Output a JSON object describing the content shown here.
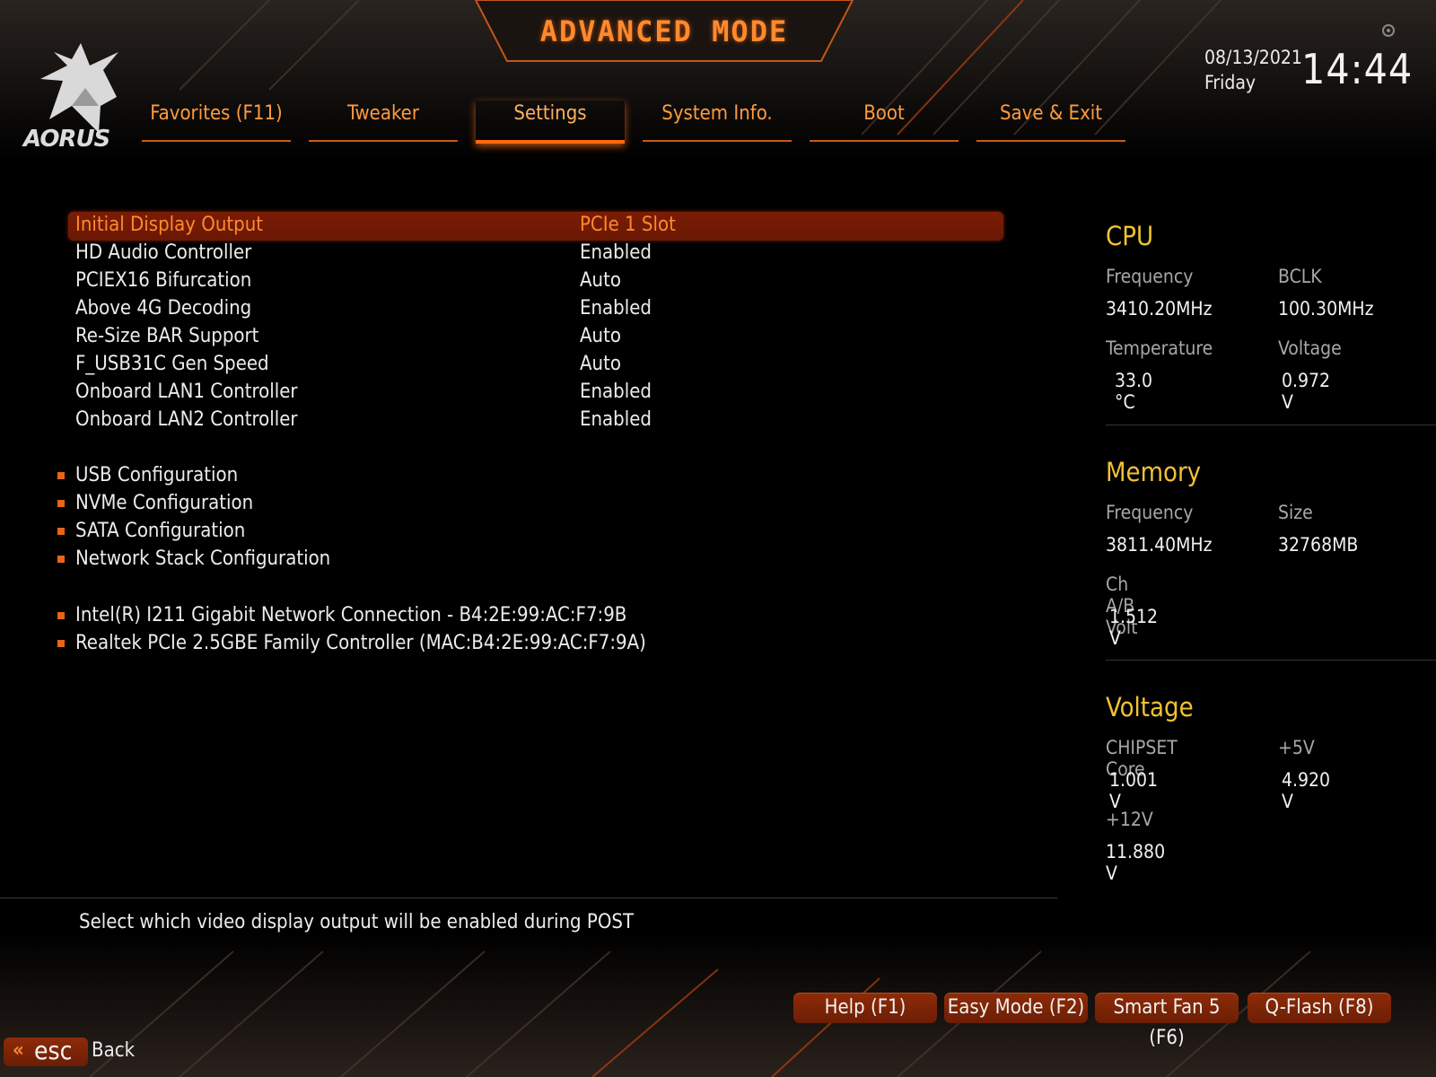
{
  "header": {
    "logo_text": "AORUS",
    "mode_title": "ADVANCED MODE",
    "tabs": [
      {
        "label": "Favorites (F11)"
      },
      {
        "label": "Tweaker"
      },
      {
        "label": "Settings"
      },
      {
        "label": "System Info."
      },
      {
        "label": "Boot"
      },
      {
        "label": "Save & Exit"
      }
    ],
    "active_tab": "Settings",
    "date": "08/13/2021",
    "weekday": "Friday",
    "time": "14:44"
  },
  "settings": [
    {
      "label": "Initial Display Output",
      "value": "PCIe 1 Slot"
    },
    {
      "label": "HD Audio Controller",
      "value": "Enabled"
    },
    {
      "label": "PCIEX16 Bifurcation",
      "value": "Auto"
    },
    {
      "label": "Above 4G Decoding",
      "value": "Enabled"
    },
    {
      "label": "Re-Size BAR Support",
      "value": "Auto"
    },
    {
      "label": "F_USB31C Gen Speed",
      "value": "Auto"
    },
    {
      "label": "Onboard LAN1 Controller",
      "value": "Enabled"
    },
    {
      "label": "Onboard LAN2 Controller",
      "value": "Enabled"
    }
  ],
  "submenus": [
    {
      "label": "USB Configuration"
    },
    {
      "label": "NVMe Configuration"
    },
    {
      "label": "SATA Configuration"
    },
    {
      "label": "Network Stack Configuration"
    }
  ],
  "network_devices": [
    {
      "label": "Intel(R) I211 Gigabit  Network Connection - B4:2E:99:AC:F7:9B"
    },
    {
      "label": "Realtek PCIe 2.5GBE Family Controller (MAC:B4:2E:99:AC:F7:9A)"
    }
  ],
  "monitor": {
    "cpu": {
      "title": "CPU",
      "freq_label": "Frequency",
      "freq_value": "3410.20MHz",
      "bclk_label": "BCLK",
      "bclk_value": "100.30MHz",
      "temp_label": "Temperature",
      "temp_value": "33.0 °C",
      "volt_label": "Voltage",
      "volt_value": "0.972 V"
    },
    "memory": {
      "title": "Memory",
      "freq_label": "Frequency",
      "freq_value": "3811.40MHz",
      "size_label": "Size",
      "size_value": "32768MB",
      "chvolt_label": "Ch A/B Volt",
      "chvolt_value": "1.512 V"
    },
    "voltage": {
      "title": "Voltage",
      "chipset_label": "CHIPSET Core",
      "chipset_value": "1.001 V",
      "p5v_label": "+5V",
      "p5v_value": "4.920 V",
      "p12v_label": "+12V",
      "p12v_value": "11.880 V"
    }
  },
  "help_text": "Select which video display output will be enabled during POST",
  "footer": {
    "buttons": [
      {
        "label": "Help (F1)"
      },
      {
        "label": "Easy Mode (F2)"
      },
      {
        "label": "Smart Fan 5 (F6)"
      },
      {
        "label": "Q-Flash (F8)"
      }
    ],
    "esc_label": "esc",
    "back_label": "Back"
  },
  "colors": {
    "accent": "#ff8a2e",
    "selection": "#7a1c05",
    "section_title": "#f1c232",
    "label_gray": "#a7a7a7"
  }
}
